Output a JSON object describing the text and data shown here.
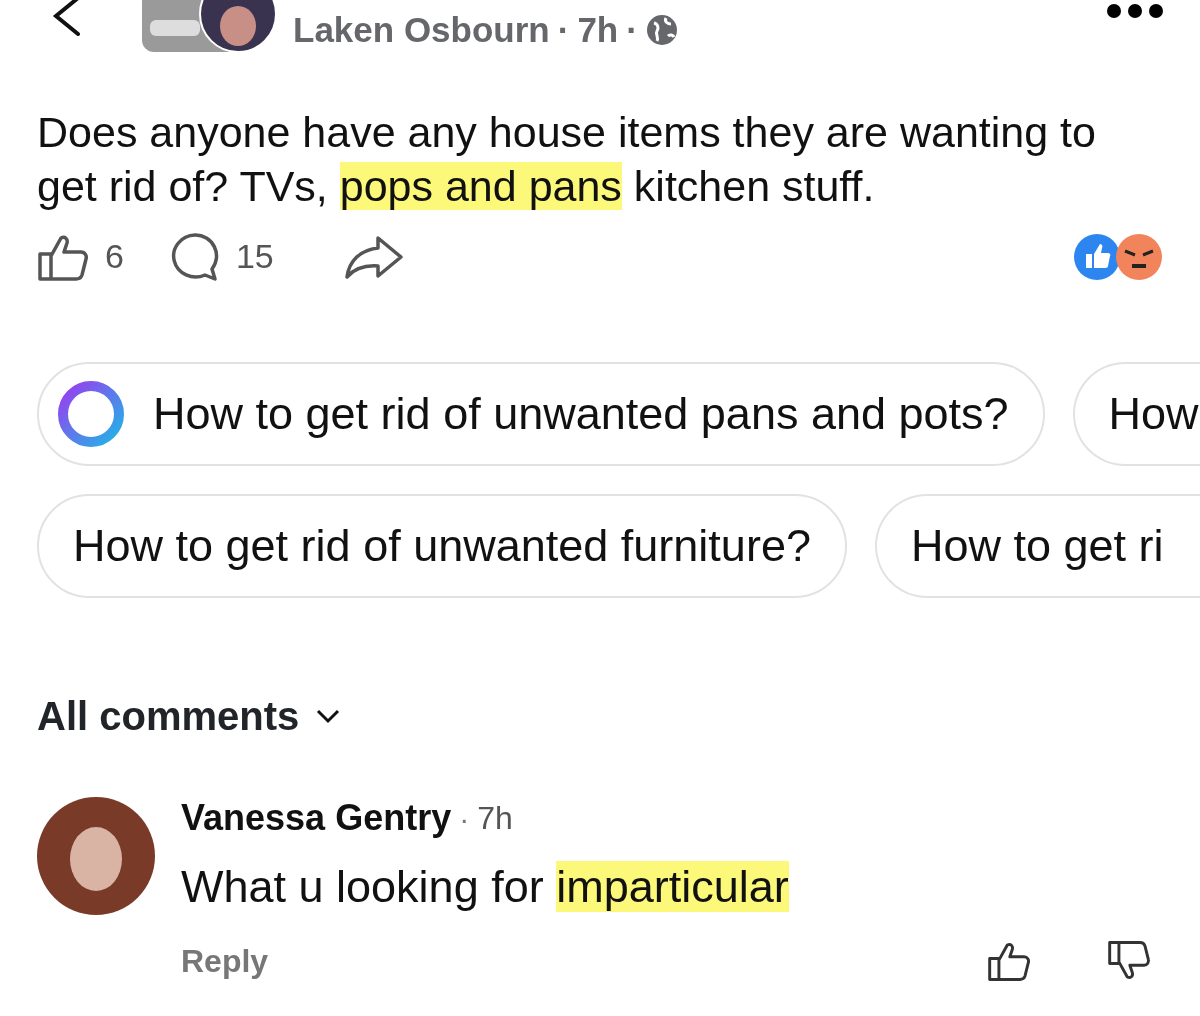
{
  "post": {
    "author": "Laken Osbourn",
    "separators": [
      "·",
      "·"
    ],
    "time": "7h",
    "text": [
      {
        "text": "Does anyone have any house items they are wanting to get rid of? TVs, ",
        "highlighted": false
      },
      {
        "text": "pops and pans",
        "highlighted": true
      },
      {
        "text": " kitchen stuff.",
        "highlighted": false
      }
    ],
    "likes": "6",
    "comments": "15"
  },
  "suggestions": [
    {
      "text": "How to get rid of unwanted pans and pots?",
      "kind": "ai"
    },
    {
      "text": "How",
      "kind": "plain"
    },
    {
      "text": "How to get rid of unwanted furniture?",
      "kind": "plain"
    },
    {
      "text": "How to get ri",
      "kind": "plain"
    }
  ],
  "comments_filter": "All comments",
  "comments": [
    {
      "author": "Vanessa Gentry",
      "separator": "·",
      "time": "7h",
      "text": [
        {
          "text": "What u looking for ",
          "highlighted": false
        },
        {
          "text": "imparticular",
          "highlighted": true
        }
      ],
      "reply": "Reply"
    }
  ]
}
